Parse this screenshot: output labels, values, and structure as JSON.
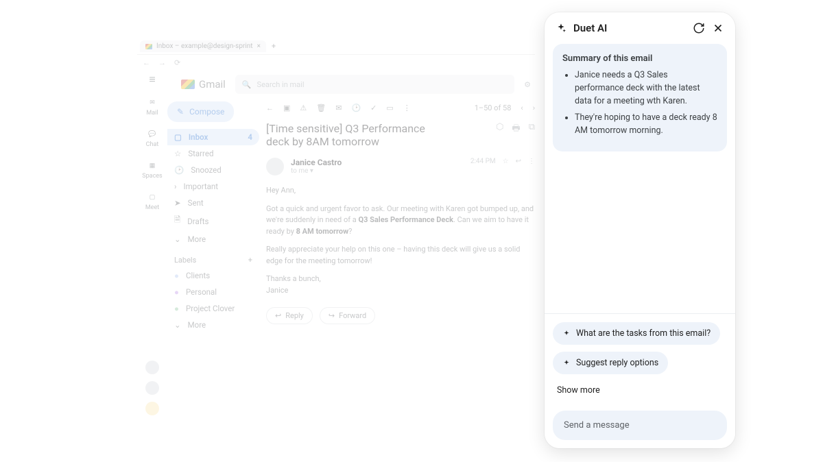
{
  "browser": {
    "tab_title": "Inbox – example@design-sprint"
  },
  "app_rail": {
    "hamburger": "≡",
    "items": [
      {
        "label": "Mail"
      },
      {
        "label": "Chat"
      },
      {
        "label": "Spaces"
      },
      {
        "label": "Meet"
      }
    ]
  },
  "gmail": {
    "product": "Gmail",
    "search_placeholder": "Search in mail",
    "compose": "Compose",
    "sidebar": [
      {
        "label": "Inbox",
        "count": "4",
        "active": true
      },
      {
        "label": "Starred"
      },
      {
        "label": "Snoozed"
      },
      {
        "label": "Important"
      },
      {
        "label": "Sent"
      },
      {
        "label": "Drafts"
      },
      {
        "label": "More"
      }
    ],
    "labels_title": "Labels",
    "labels": [
      {
        "label": "Clients"
      },
      {
        "label": "Personal"
      },
      {
        "label": "Project Clover"
      },
      {
        "label": "More"
      }
    ],
    "pager": "1–50 of 58",
    "subject": "[Time sensitive] Q3 Performance deck by 8AM tomorrow",
    "sender": "Janice Castro",
    "to": "to me",
    "time": "2:44 PM",
    "body_hello": "Hey Ann,",
    "body_p1_a": "Got a quick and urgent favor to ask. Our meeting with Karen got bumped up, and we're suddenly in need of a ",
    "body_p1_bold1": "Q3 Sales Performance Deck",
    "body_p1_b": ". Can we aim to have it ready by ",
    "body_p1_bold2": "8 AM tomorrow",
    "body_p1_c": "?",
    "body_p2": "Really appreciate your help on this one – having this deck will give us a solid edge for the meeting tomorrow!",
    "body_close1": "Thanks a bunch,",
    "body_close2": "Janice",
    "reply": "Reply",
    "forward": "Forward"
  },
  "duet": {
    "title": "Duet AI",
    "summary_heading": "Summary of this email",
    "summary_items": [
      "Janice needs a Q3 Sales performance deck with the latest data for a meeting wth Karen.",
      "They're hoping to have a deck ready 8 AM tomorrow morning."
    ],
    "suggestions": [
      "What are the tasks from this email?",
      "Suggest reply options"
    ],
    "show_more": "Show more",
    "send_placeholder": "Send a message"
  }
}
